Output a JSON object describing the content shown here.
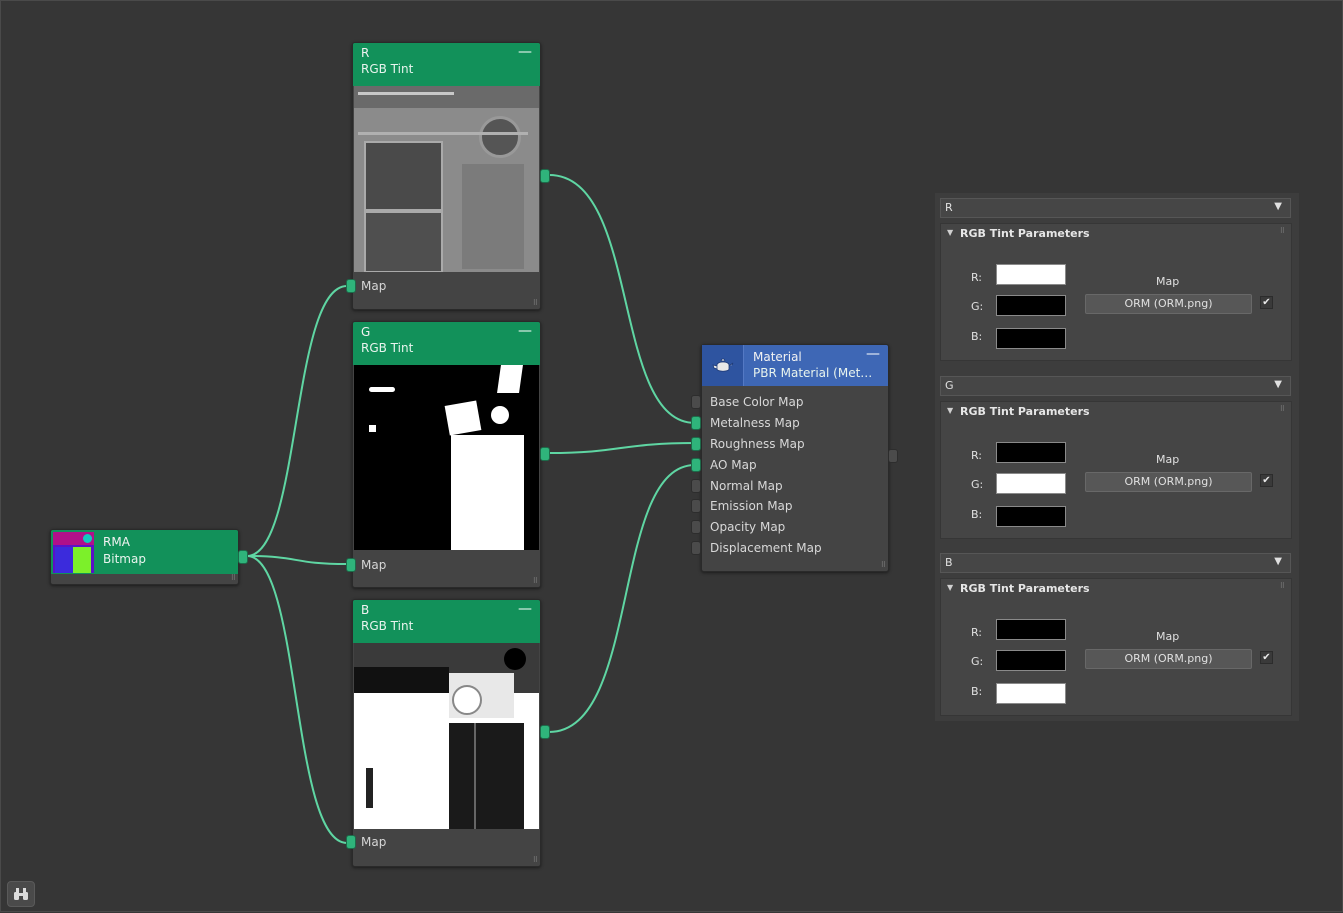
{
  "nodes": {
    "r": {
      "title": "R",
      "subtitle": "RGB Tint",
      "map_label": "Map",
      "collapse": "—"
    },
    "g": {
      "title": "G",
      "subtitle": "RGB Tint",
      "map_label": "Map",
      "collapse": "—"
    },
    "b": {
      "title": "B",
      "subtitle": "RGB Tint",
      "map_label": "Map",
      "collapse": "—"
    },
    "rma": {
      "title": "RMA",
      "subtitle": "Bitmap"
    },
    "material": {
      "title": "Material",
      "subtitle": "PBR Material (Met…",
      "collapse": "—",
      "slots": [
        {
          "label": "Base Color Map",
          "connected": false
        },
        {
          "label": "Metalness Map",
          "connected": true
        },
        {
          "label": "Roughness Map",
          "connected": true
        },
        {
          "label": "AO Map",
          "connected": true
        },
        {
          "label": "Normal Map",
          "connected": false
        },
        {
          "label": "Emission Map",
          "connected": false
        },
        {
          "label": "Opacity Map",
          "connected": false
        },
        {
          "label": "Displacement Map",
          "connected": false
        }
      ]
    }
  },
  "panel": {
    "sections": [
      {
        "rollout": "R",
        "group_title": "RGB Tint Parameters",
        "labels": {
          "r": "R:",
          "g": "G:",
          "b": "B:"
        },
        "colors": {
          "r": "#ffffff",
          "g": "#000000",
          "b": "#000000"
        },
        "map_header": "Map",
        "map_button": "ORM (ORM.png)",
        "checked": true
      },
      {
        "rollout": "G",
        "group_title": "RGB Tint Parameters",
        "labels": {
          "r": "R:",
          "g": "G:",
          "b": "B:"
        },
        "colors": {
          "r": "#000000",
          "g": "#ffffff",
          "b": "#000000"
        },
        "map_header": "Map",
        "map_button": "ORM (ORM.png)",
        "checked": true
      },
      {
        "rollout": "B",
        "group_title": "RGB Tint Parameters",
        "labels": {
          "r": "R:",
          "g": "G:",
          "b": "B:"
        },
        "colors": {
          "r": "#000000",
          "g": "#000000",
          "b": "#ffffff"
        },
        "map_header": "Map",
        "map_button": "ORM (ORM.png)",
        "checked": true
      }
    ]
  },
  "icons": {
    "material": "teapot-icon",
    "bottom": "binoculars-icon",
    "rollout_arrow": "▼",
    "group_arrow": "▼",
    "check": "✔"
  },
  "colors": {
    "canvas": "#363636",
    "node_header_green": "#12915a",
    "material_header_blue": "#3e67b5",
    "wire": "#5fd6a3",
    "port_connected": "#2fb47b"
  }
}
